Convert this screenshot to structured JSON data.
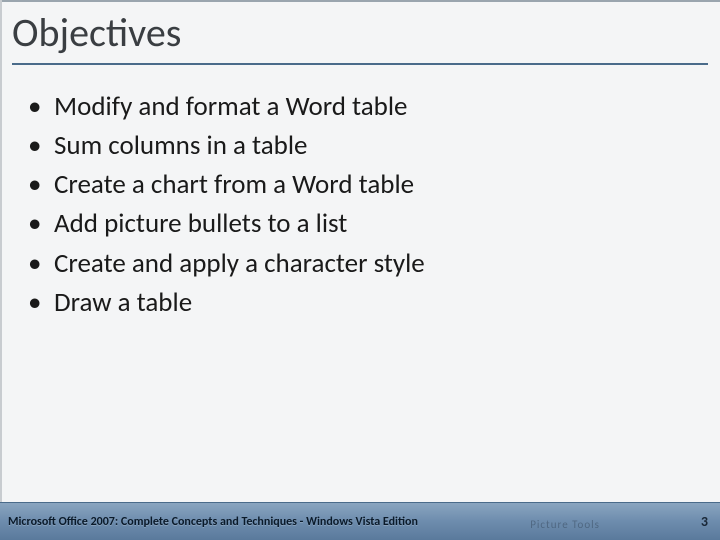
{
  "title": "Objectives",
  "bullets": [
    "Modify and format a Word table",
    "Sum columns in a table",
    "Create a chart from a Word table",
    "Add picture bullets to a list",
    "Create and apply a character style",
    "Draw a table"
  ],
  "footer": {
    "left": "Microsoft Office 2007: Complete Concepts and Techniques - Windows Vista Edition",
    "ghost": "Picture Tools",
    "page": "3"
  }
}
